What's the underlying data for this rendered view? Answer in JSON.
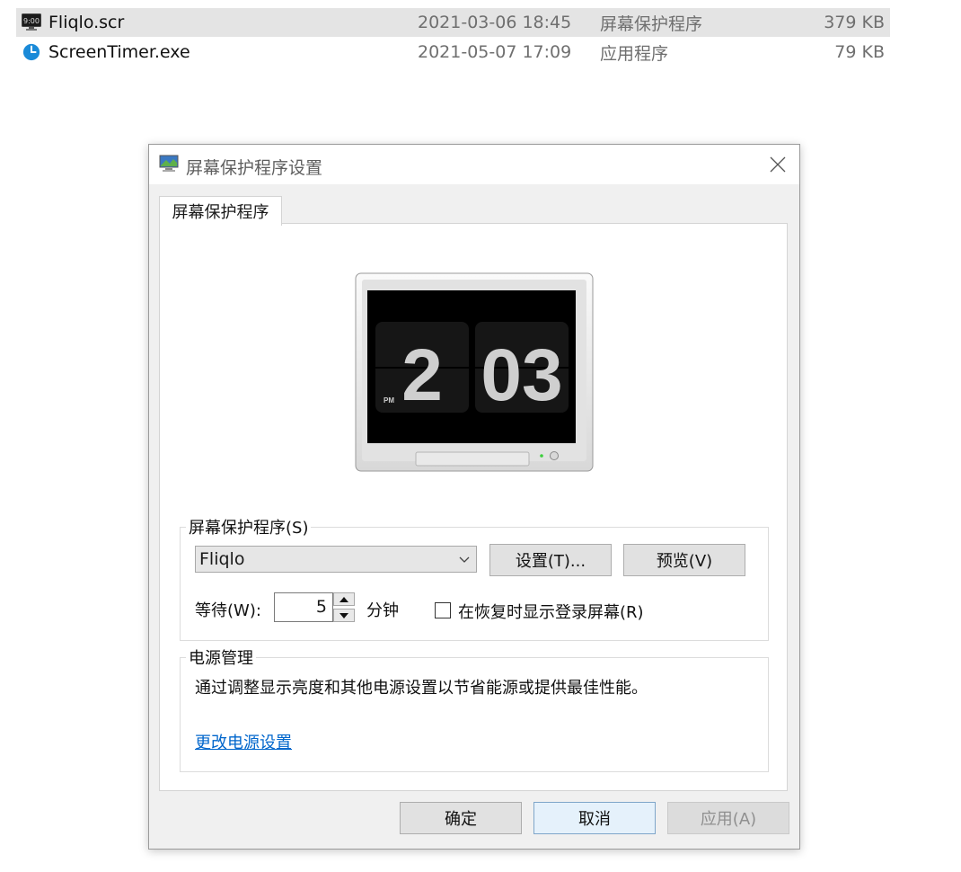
{
  "file_list": [
    {
      "name": "Fliqlo.scr",
      "date": "2021-03-06 18:45",
      "type": "屏幕保护程序",
      "size": "379 KB",
      "icon": "fliqlo-screensaver-icon",
      "selected": true
    },
    {
      "name": "ScreenTimer.exe",
      "date": "2021-05-07 17:09",
      "type": "应用程序",
      "size": "79 KB",
      "icon": "clock-app-icon",
      "selected": false
    }
  ],
  "dialog": {
    "title": "屏幕保护程序设置",
    "tab_label": "屏幕保护程序",
    "preview": {
      "hours": "2",
      "minutes": "03",
      "ampm": "PM"
    },
    "screensaver_group": {
      "legend": "屏幕保护程序(S)",
      "selected": "Fliqlo",
      "settings_button": "设置(T)...",
      "preview_button": "预览(V)",
      "wait_label": "等待(W):",
      "wait_value": "5",
      "wait_unit": "分钟",
      "resume_checkbox_label": "在恢复时显示登录屏幕(R)",
      "resume_checked": false
    },
    "power_group": {
      "legend": "电源管理",
      "description": "通过调整显示亮度和其他电源设置以节省能源或提供最佳性能。",
      "link": "更改电源设置"
    },
    "buttons": {
      "ok": "确定",
      "cancel": "取消",
      "apply": "应用(A)"
    }
  },
  "colors": {
    "link": "#0066cc",
    "selection": "#e4e4e4",
    "dialog_bg": "#f0f0f0"
  }
}
